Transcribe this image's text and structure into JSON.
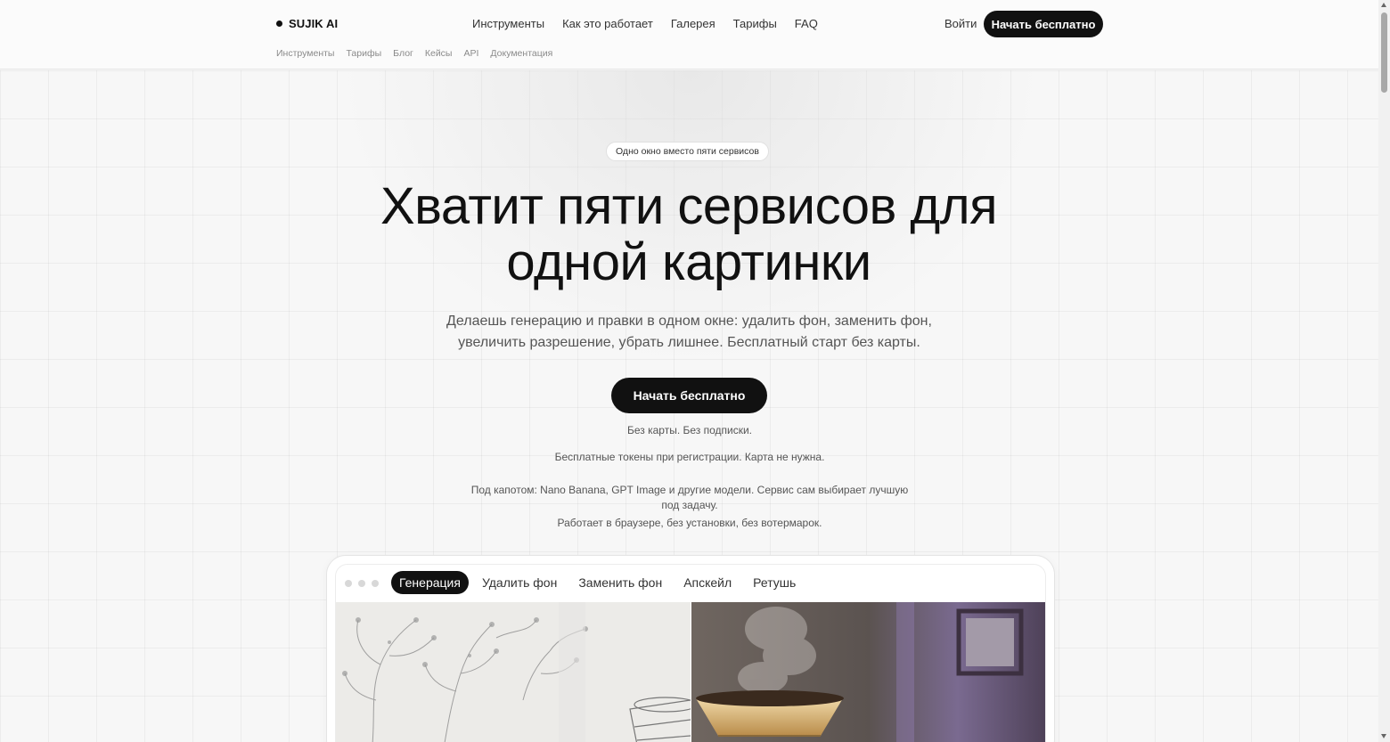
{
  "header": {
    "logo": "SUJIK AI",
    "nav": [
      "Инструменты",
      "Как это работает",
      "Галерея",
      "Тарифы",
      "FAQ"
    ],
    "login_label": "Войти",
    "cta_label": "Начать бесплатно",
    "sub_nav": [
      "Инструменты",
      "Тарифы",
      "Блог",
      "Кейсы",
      "API",
      "Документация"
    ]
  },
  "hero": {
    "badge": "Одно окно вместо пяти сервисов",
    "title_line1": "Хватит пяти сервисов для",
    "title_line2": "одной картинки",
    "subtitle_line1": "Делаешь генерацию и правки в одном окне: удалить фон, заменить фон,",
    "subtitle_line2": "увеличить разрешение, убрать лишнее. Бесплатный старт без карты.",
    "cta_label": "Начать бесплатно",
    "note1": "Без карты. Без подписки.",
    "note2": "Бесплатные токены при регистрации. Карта не нужна.",
    "note3": "Под капотом: Nano Banana, GPT Image и другие модели. Сервис сам выбирает лучшую под задачу.",
    "note4": "Работает в браузере, без установки, без вотермарок."
  },
  "demo": {
    "tabs": [
      "Генерация",
      "Удалить фон",
      "Заменить фон",
      "Апскейл",
      "Ретушь"
    ],
    "active_tab": "Генерация"
  },
  "colors": {
    "primary": "#111111",
    "background": "#f7f7f7",
    "muted_text": "#8a8a8a"
  }
}
